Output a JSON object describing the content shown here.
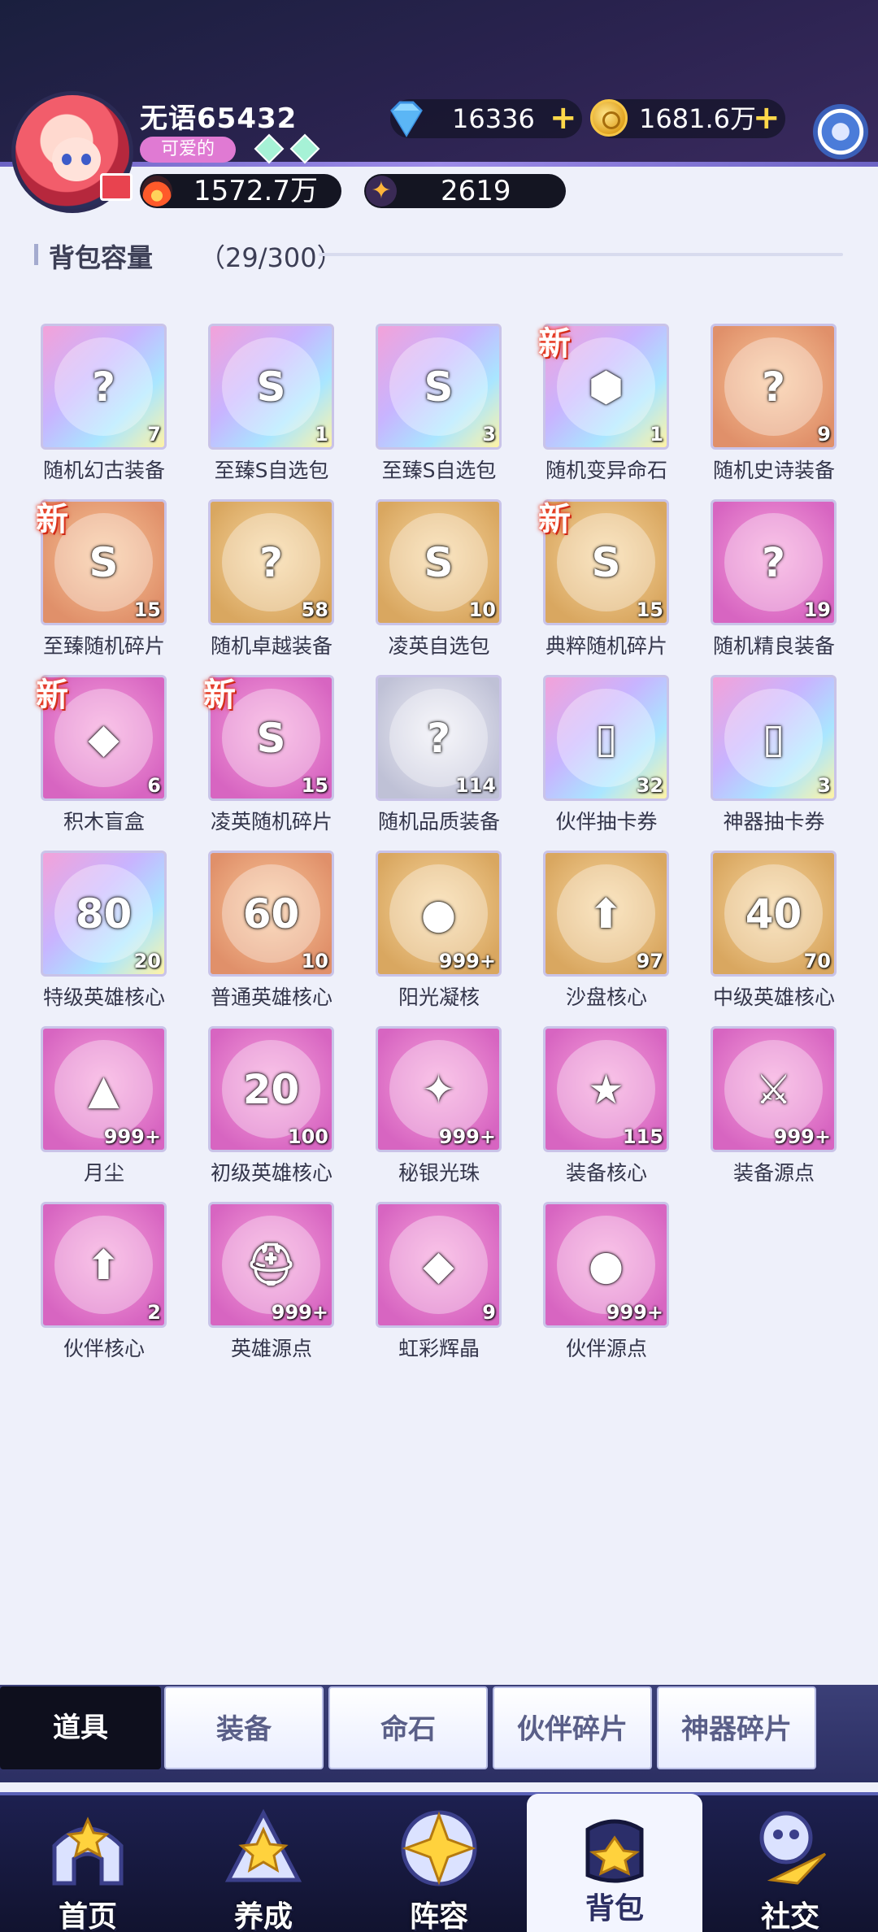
{
  "header": {
    "username": "无语65432",
    "tag": "可爱的",
    "diamonds": "16336",
    "gold": "1681.6万",
    "power": "1572.7万",
    "stars": "2619"
  },
  "capacity": {
    "label": "背包容量",
    "count": "（29/300）"
  },
  "items": [
    {
      "name": "随机幻古装备",
      "count": "7",
      "new": false,
      "glyph": "?",
      "bg": "rainbow"
    },
    {
      "name": "至臻S自选包",
      "count": "1",
      "new": false,
      "glyph": "S",
      "bg": "rainbow"
    },
    {
      "name": "至臻S自选包",
      "count": "3",
      "new": false,
      "glyph": "S",
      "bg": "rainbow"
    },
    {
      "name": "随机变异命石",
      "count": "1",
      "new": true,
      "glyph": "⬢",
      "bg": "rainbow"
    },
    {
      "name": "随机史诗装备",
      "count": "9",
      "new": false,
      "glyph": "?",
      "bg": "orange"
    },
    {
      "name": "至臻随机碎片",
      "count": "15",
      "new": true,
      "glyph": "S",
      "bg": "orange"
    },
    {
      "name": "随机卓越装备",
      "count": "58",
      "new": false,
      "glyph": "?",
      "bg": "gold"
    },
    {
      "name": "凌英自选包",
      "count": "10",
      "new": false,
      "glyph": "S",
      "bg": "gold"
    },
    {
      "name": "典粹随机碎片",
      "count": "15",
      "new": true,
      "glyph": "S",
      "bg": "gold"
    },
    {
      "name": "随机精良装备",
      "count": "19",
      "new": false,
      "glyph": "?",
      "bg": "pink"
    },
    {
      "name": "积木盲盒",
      "count": "6",
      "new": true,
      "glyph": "◆",
      "bg": "pink"
    },
    {
      "name": "凌英随机碎片",
      "count": "15",
      "new": true,
      "glyph": "S",
      "bg": "pink"
    },
    {
      "name": "随机品质装备",
      "count": "114",
      "new": false,
      "glyph": "?",
      "bg": "gray"
    },
    {
      "name": "伙伴抽卡券",
      "count": "32",
      "new": false,
      "glyph": "▯",
      "bg": "rainbow"
    },
    {
      "name": "神器抽卡券",
      "count": "3",
      "new": false,
      "glyph": "▯",
      "bg": "rainbow"
    },
    {
      "name": "特级英雄核心",
      "count": "20",
      "new": false,
      "glyph": "80",
      "bg": "rainbow"
    },
    {
      "name": "普通英雄核心",
      "count": "10",
      "new": false,
      "glyph": "60",
      "bg": "orange"
    },
    {
      "name": "阳光凝核",
      "count": "999+",
      "new": false,
      "glyph": "●",
      "bg": "gold"
    },
    {
      "name": "沙盘核心",
      "count": "97",
      "new": false,
      "glyph": "⬆",
      "bg": "gold"
    },
    {
      "name": "中级英雄核心",
      "count": "70",
      "new": false,
      "glyph": "40",
      "bg": "gold"
    },
    {
      "name": "月尘",
      "count": "999+",
      "new": false,
      "glyph": "▲",
      "bg": "pink"
    },
    {
      "name": "初级英雄核心",
      "count": "100",
      "new": false,
      "glyph": "20",
      "bg": "pink"
    },
    {
      "name": "秘银光珠",
      "count": "999+",
      "new": false,
      "glyph": "✦",
      "bg": "pink"
    },
    {
      "name": "装备核心",
      "count": "115",
      "new": false,
      "glyph": "★",
      "bg": "pink"
    },
    {
      "name": "装备源点",
      "count": "999+",
      "new": false,
      "glyph": "⚔",
      "bg": "pink"
    },
    {
      "name": "伙伴核心",
      "count": "2",
      "new": false,
      "glyph": "⬆",
      "bg": "pink"
    },
    {
      "name": "英雄源点",
      "count": "999+",
      "new": false,
      "glyph": "⛑",
      "bg": "pink"
    },
    {
      "name": "虹彩辉晶",
      "count": "9",
      "new": false,
      "glyph": "◆",
      "bg": "pink"
    },
    {
      "name": "伙伴源点",
      "count": "999+",
      "new": false,
      "glyph": "●",
      "bg": "pink"
    }
  ],
  "new_badge": "新",
  "tabs": [
    "道具",
    "装备",
    "命石",
    "伙伴碎片",
    "神器碎片"
  ],
  "nav": [
    "首页",
    "养成",
    "阵容",
    "背包",
    "社交"
  ],
  "colors": {
    "accent": "#d765c1",
    "nav_bg": "#1d2050",
    "page_bg": "#eef0fa"
  }
}
